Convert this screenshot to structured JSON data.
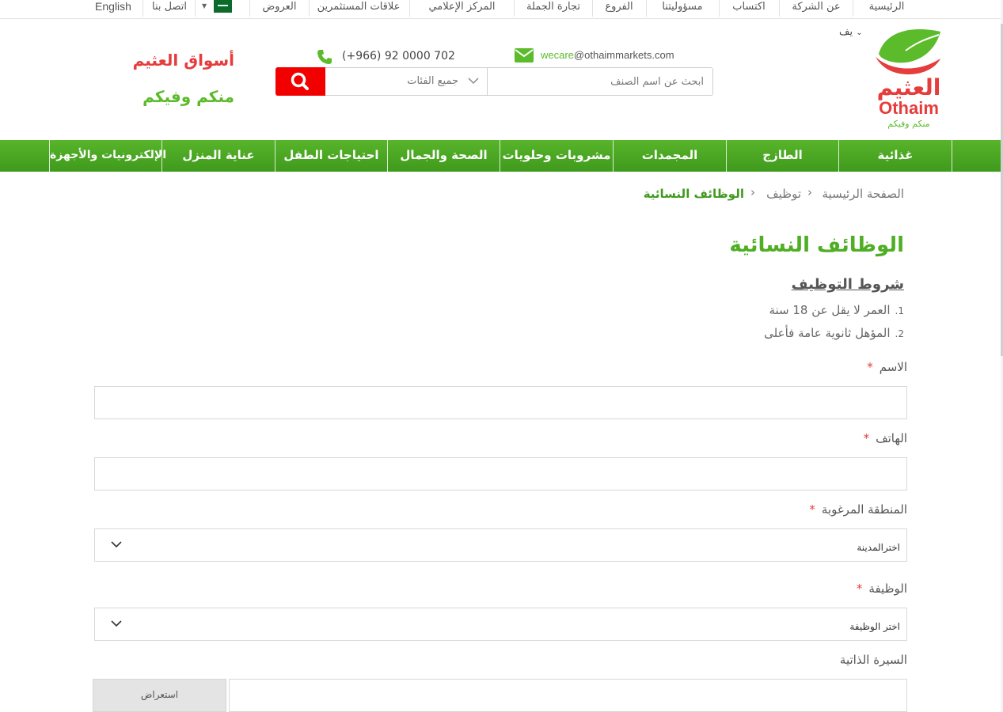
{
  "topbar": {
    "links": [
      "الرئيسية",
      "عن الشركة",
      "اكتساب",
      "مسؤوليتنا",
      "الفروع",
      "تجارة الجملة",
      "المركز الإعلامي",
      "علاقات المستثمرين",
      "العروض"
    ],
    "contact": "اتصل بنا",
    "language": "English"
  },
  "header": {
    "logo_ar": "العثيم",
    "logo_en": "Othaim",
    "logo_tag": "منكم وفيكم",
    "lang_partial": "يف",
    "slogan_line1": "أسواق العثيم",
    "slogan_line2": "منكم وفيكم",
    "phone": "(+966) 92 0000 702",
    "email_user": "wecare",
    "email_domain": "@othaimmarkets.com",
    "search_placeholder": "ابحث عن اسم الصنف",
    "category_label": "جميع الفئات"
  },
  "nav": {
    "items": [
      "غذائية",
      "الطازج",
      "المجمدات",
      "مشروبات وحلويات",
      "الصحة والجمال",
      "احتياجات الطفل",
      "عناية المنزل",
      "الإلكترونيات والأجهزة"
    ]
  },
  "breadcrumb": {
    "home": "الصفحة الرئيسية",
    "section": "توظيف",
    "current": "الوظائف النسائية"
  },
  "page": {
    "title": "الوظائف النسائية",
    "conditions_title": "شروط التوظيف",
    "conditions": [
      {
        "num": "1.",
        "text": "العمر لا يقل عن 18 سنة"
      },
      {
        "num": "2.",
        "text": "المؤهل ثانوية عامة فأعلى"
      }
    ]
  },
  "form": {
    "required_mark": "*",
    "name_label": "الاسم",
    "phone_label": "الهاتف",
    "region_label": "المنطقة المرغوبة",
    "region_value": "اخترالمدينة",
    "job_label": "الوظيفة",
    "job_value": "اختر الوظيفة",
    "cv_label": "السيرة الذاتية",
    "browse_label": "استعراض"
  },
  "colors": {
    "brand_green": "#4fae24",
    "brand_red": "#f20000",
    "nav_green": "#3f9a1d"
  }
}
